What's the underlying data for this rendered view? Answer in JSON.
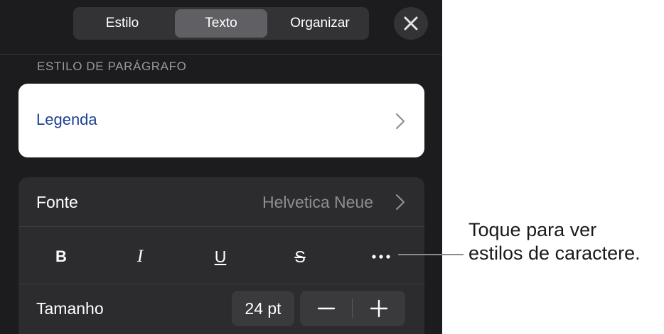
{
  "tabs": [
    {
      "label": "Estilo",
      "active": false
    },
    {
      "label": "Texto",
      "active": true
    },
    {
      "label": "Organizar",
      "active": false
    }
  ],
  "close_icon": "close-icon",
  "paragraph_style": {
    "section_label": "ESTILO DE PARÁGRAFO",
    "value": "Legenda",
    "value_color": "#1c3f91"
  },
  "font": {
    "label": "Fonte",
    "value": "Helvetica Neue"
  },
  "character_styles": {
    "bold": "B",
    "italic": "I",
    "underline": "U",
    "strikethrough": "S",
    "more_icon": "ellipsis-icon"
  },
  "size": {
    "label": "Tamanho",
    "value": "24 pt",
    "decrement_icon": "minus-icon",
    "increment_icon": "plus-icon"
  },
  "callout": {
    "line1": "Toque para ver",
    "line2": "estilos de caractere."
  },
  "colors": {
    "panel_bg": "#1c1c1e",
    "group_bg": "#2c2c2e",
    "accent_text": "#1c3f91"
  }
}
